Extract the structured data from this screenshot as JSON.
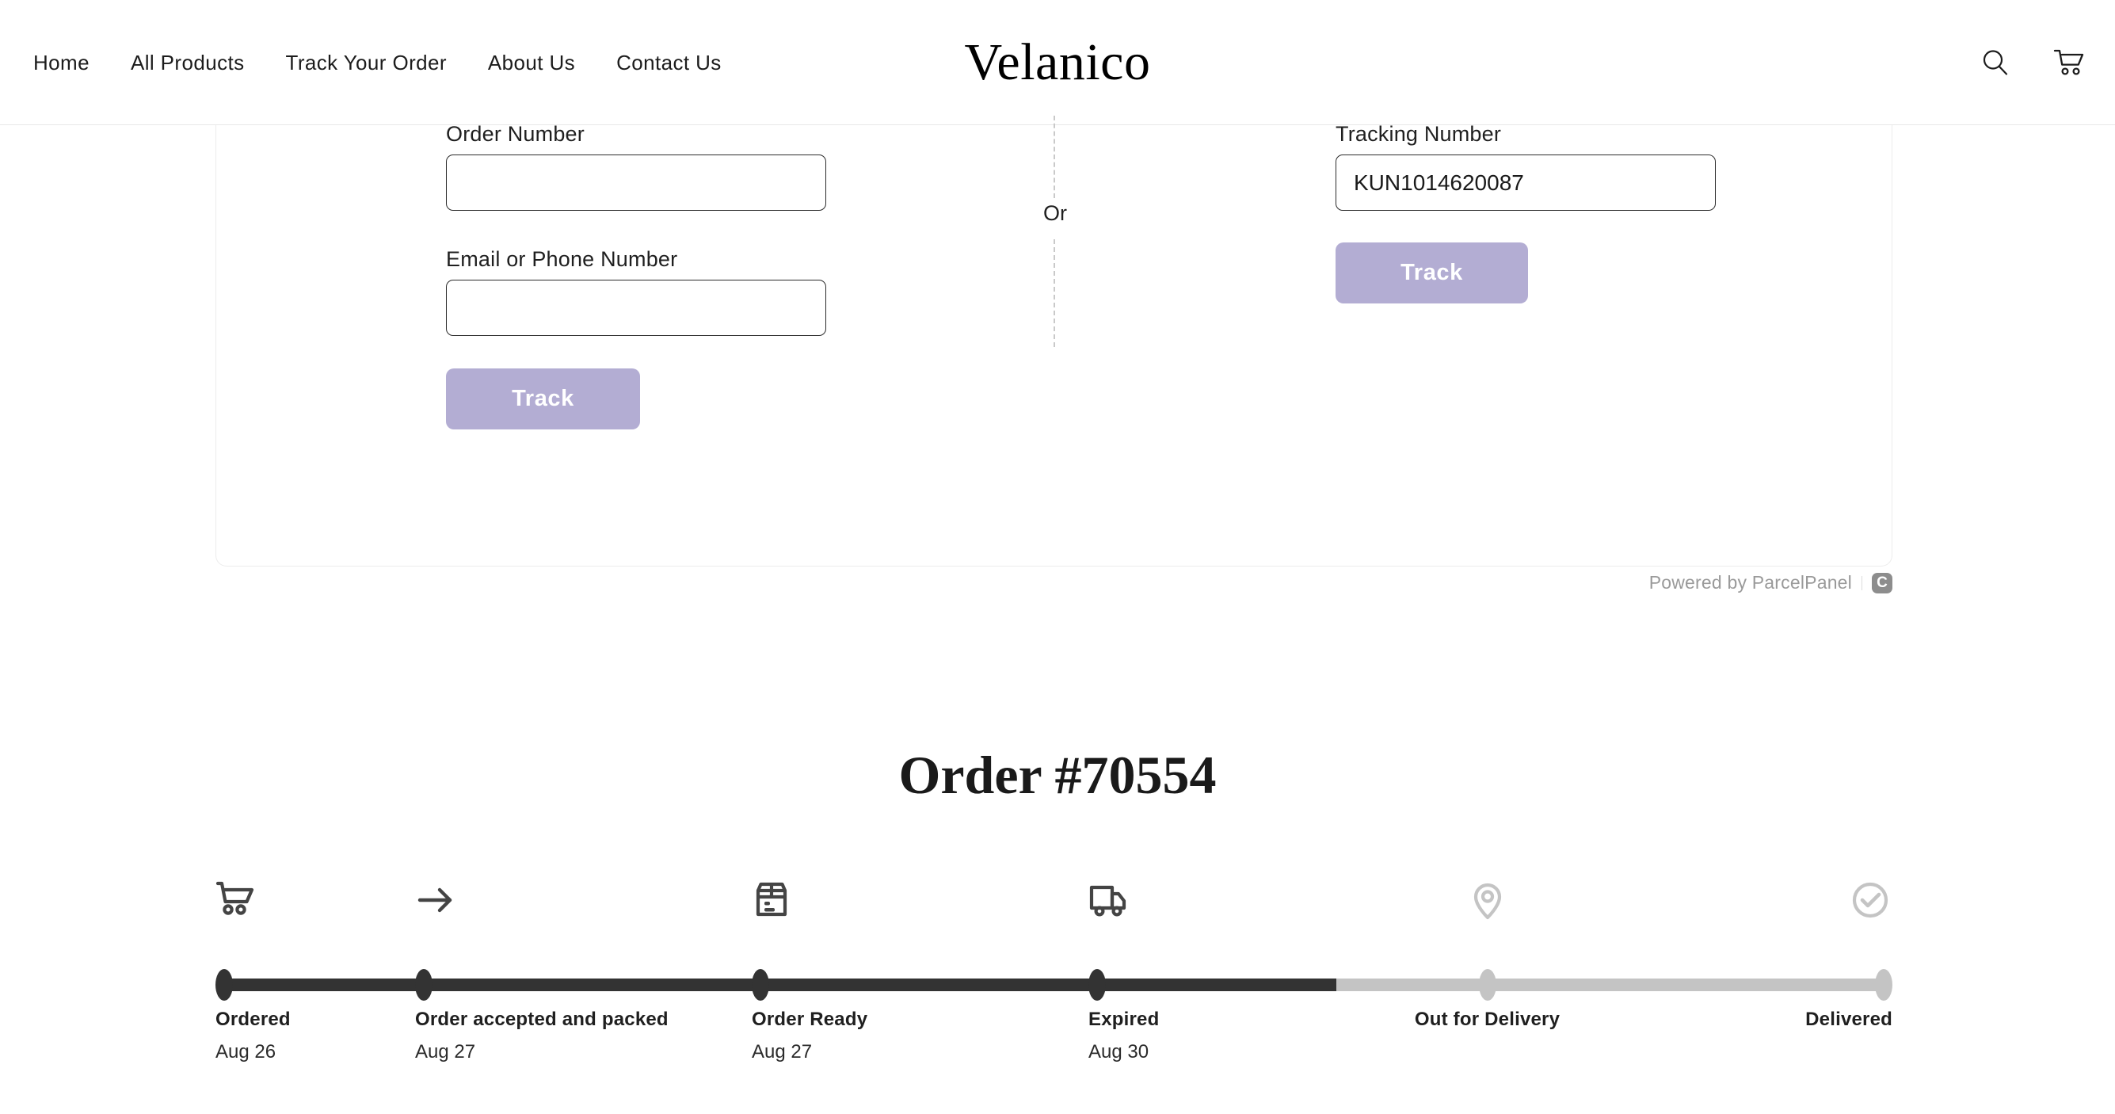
{
  "header": {
    "brand": "Velanico",
    "nav": [
      {
        "label": "Home",
        "name": "nav-home"
      },
      {
        "label": "All Products",
        "name": "nav-all-products"
      },
      {
        "label": "Track Your Order",
        "name": "nav-track-your-order"
      },
      {
        "label": "About Us",
        "name": "nav-about-us"
      },
      {
        "label": "Contact Us",
        "name": "nav-contact-us"
      }
    ],
    "search_icon": "search-icon",
    "cart_icon": "cart-icon"
  },
  "track_card": {
    "order_number": {
      "label": "Order Number",
      "value": "",
      "placeholder": ""
    },
    "contact": {
      "label": "Email or Phone Number",
      "value": "",
      "placeholder": ""
    },
    "order_track_button": "Track",
    "divider_text": "Or",
    "tracking_number": {
      "label": "Tracking Number",
      "value": "KUN1014620087",
      "placeholder": ""
    },
    "tracking_track_button": "Track",
    "accent_color": "#b3add3"
  },
  "powered_by": {
    "text": "Powered by ParcelPanel",
    "icon_glyph": "C",
    "icon_name": "parcelpanel-logo-icon"
  },
  "order": {
    "title": "Order #70554"
  },
  "timeline": {
    "progress_percent": 67,
    "active_color": "#333333",
    "pending_color": "#c4c4c4",
    "steps": [
      {
        "label": "Ordered",
        "date": "Aug 26",
        "icon": "shopping-cart-icon",
        "state": "complete"
      },
      {
        "label": "Order accepted and packed",
        "date": "Aug 27",
        "icon": "arrow-right-icon",
        "state": "complete"
      },
      {
        "label": "Order Ready",
        "date": "Aug 27",
        "icon": "package-box-icon",
        "state": "complete"
      },
      {
        "label": "Expired",
        "date": "Aug 30",
        "icon": "delivery-truck-icon",
        "state": "complete"
      },
      {
        "label": "Out for Delivery",
        "date": "",
        "icon": "map-pin-icon",
        "state": "pending"
      },
      {
        "label": "Delivered",
        "date": "",
        "icon": "check-circle-icon",
        "state": "pending"
      }
    ]
  }
}
